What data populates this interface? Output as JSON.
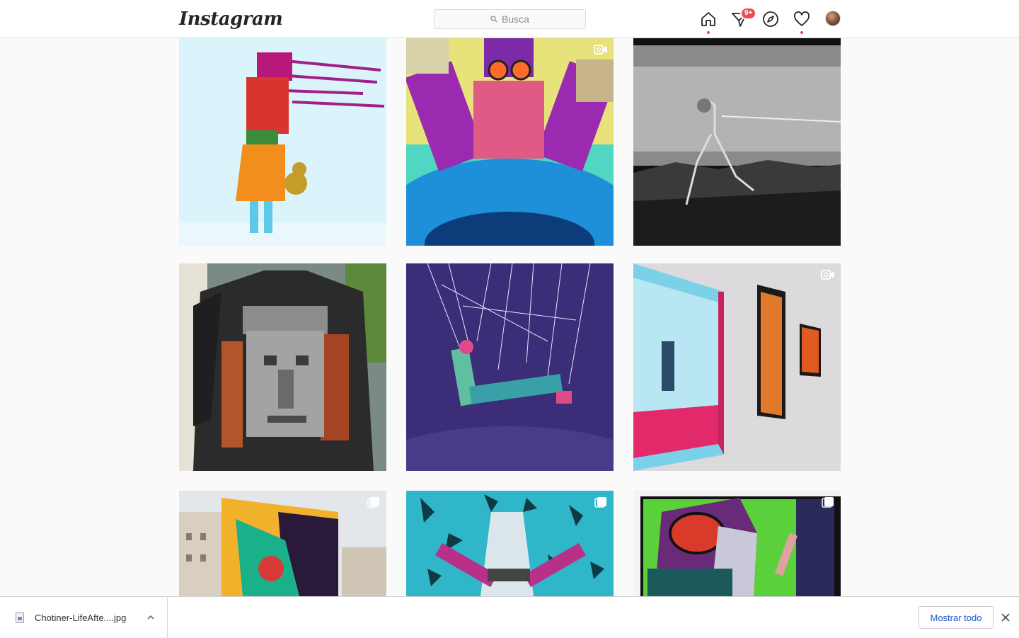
{
  "header": {
    "logo": "Instagram",
    "search_placeholder": "Busca",
    "notifications_badge": "9+"
  },
  "posts": [
    {
      "id": 1,
      "type": "single"
    },
    {
      "id": 2,
      "type": "video"
    },
    {
      "id": 3,
      "type": "single"
    },
    {
      "id": 4,
      "type": "single"
    },
    {
      "id": 5,
      "type": "single"
    },
    {
      "id": 6,
      "type": "video"
    },
    {
      "id": 7,
      "type": "carousel"
    },
    {
      "id": 8,
      "type": "carousel"
    },
    {
      "id": 9,
      "type": "carousel"
    }
  ],
  "download_bar": {
    "file_name": "Chotiner-LifeAfte....jpg",
    "show_all_label": "Mostrar todo"
  },
  "colors": {
    "accent_red": "#ed4956",
    "link_blue": "#1a57c7"
  }
}
